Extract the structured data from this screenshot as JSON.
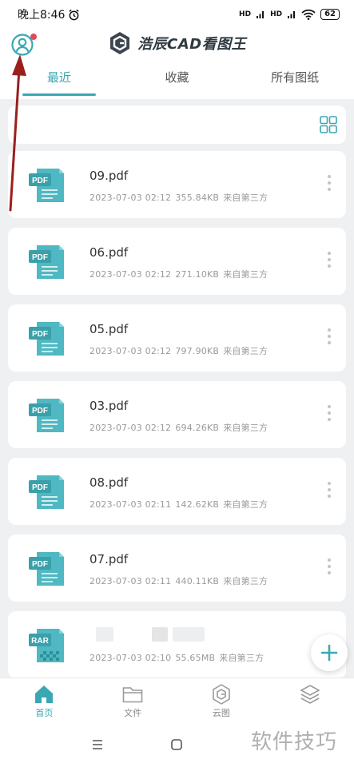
{
  "status_bar": {
    "time": "晚上8:46",
    "signal_1": "HD",
    "signal_2": "HD",
    "battery": "62"
  },
  "header": {
    "app_name": "浩辰CAD看图王",
    "tabs": [
      {
        "label": "最近",
        "active": true
      },
      {
        "label": "收藏",
        "active": false
      },
      {
        "label": "所有图纸",
        "active": false
      }
    ]
  },
  "files": [
    {
      "name": "09.pdf",
      "type": "PDF",
      "date": "2023-07-03 02:12",
      "size": "355.84KB",
      "source": "来自第三方"
    },
    {
      "name": "06.pdf",
      "type": "PDF",
      "date": "2023-07-03 02:12",
      "size": "271.10KB",
      "source": "来自第三方"
    },
    {
      "name": "05.pdf",
      "type": "PDF",
      "date": "2023-07-03 02:12",
      "size": "797.90KB",
      "source": "来自第三方"
    },
    {
      "name": "03.pdf",
      "type": "PDF",
      "date": "2023-07-03 02:12",
      "size": "694.26KB",
      "source": "来自第三方"
    },
    {
      "name": "08.pdf",
      "type": "PDF",
      "date": "2023-07-03 02:11",
      "size": "142.62KB",
      "source": "来自第三方"
    },
    {
      "name": "07.pdf",
      "type": "PDF",
      "date": "2023-07-03 02:11",
      "size": "440.11KB",
      "source": "来自第三方"
    },
    {
      "name": "",
      "type": "RAR",
      "date": "2023-07-03 02:10",
      "size": "55.65MB",
      "source": "来自第三方"
    }
  ],
  "bottom_nav": [
    {
      "label": "首页",
      "icon": "home-icon",
      "active": true
    },
    {
      "label": "文件",
      "icon": "folder-icon",
      "active": false
    },
    {
      "label": "云图",
      "icon": "cloud-logo-icon",
      "active": false
    },
    {
      "label": "",
      "icon": "layers-icon",
      "active": false
    }
  ],
  "watermark": "软件技巧",
  "colors": {
    "accent": "#3aa8b2",
    "file_icon": "#4fb8c2",
    "badge": "#e5475a",
    "annotation_arrow": "#9a1f1f"
  }
}
